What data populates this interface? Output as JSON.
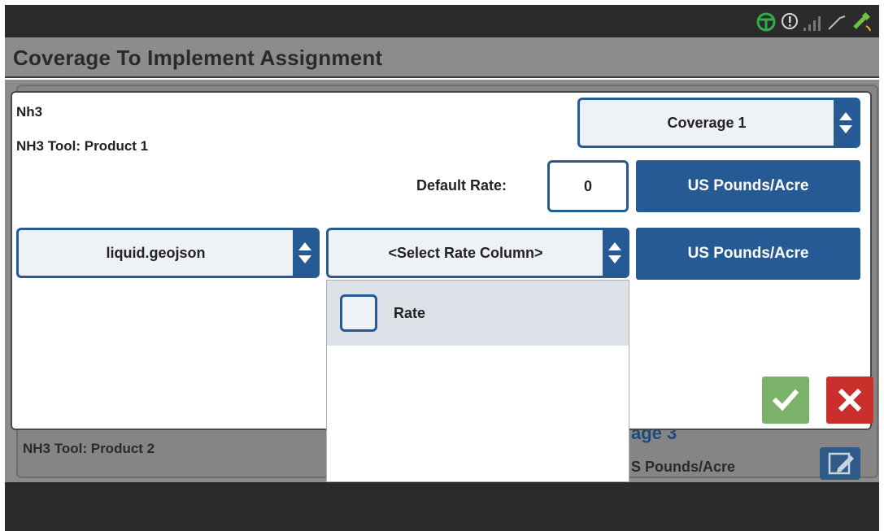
{
  "status": {
    "icons": [
      "gps-wheel-icon",
      "alert-icon",
      "signal-bars-icon",
      "antenna-icon",
      "satellite-icon"
    ],
    "accent": "#2fae4a"
  },
  "header": {
    "title": "Coverage To Implement Assignment"
  },
  "background": {
    "product2_label": "NH3 Tool: Product 2",
    "coverage3_label": "age 3",
    "units_label": "S Pounds/Acre"
  },
  "dialog": {
    "product_name": "Nh3",
    "tool_label": "NH3 Tool: Product 1",
    "coverage_select": "Coverage 1",
    "default_rate_label": "Default Rate:",
    "default_rate_value": "0",
    "units_button_1": "US Pounds/Acre",
    "file_select": "liquid.geojson",
    "rate_column_select": "<Select Rate Column>",
    "units_button_2": "US Pounds/Acre",
    "dropdown": {
      "items": [
        {
          "label": "Rate",
          "checked": false
        }
      ]
    }
  },
  "colors": {
    "primary": "#255a95",
    "confirm": "#7bb26a",
    "cancel": "#c9302c"
  }
}
